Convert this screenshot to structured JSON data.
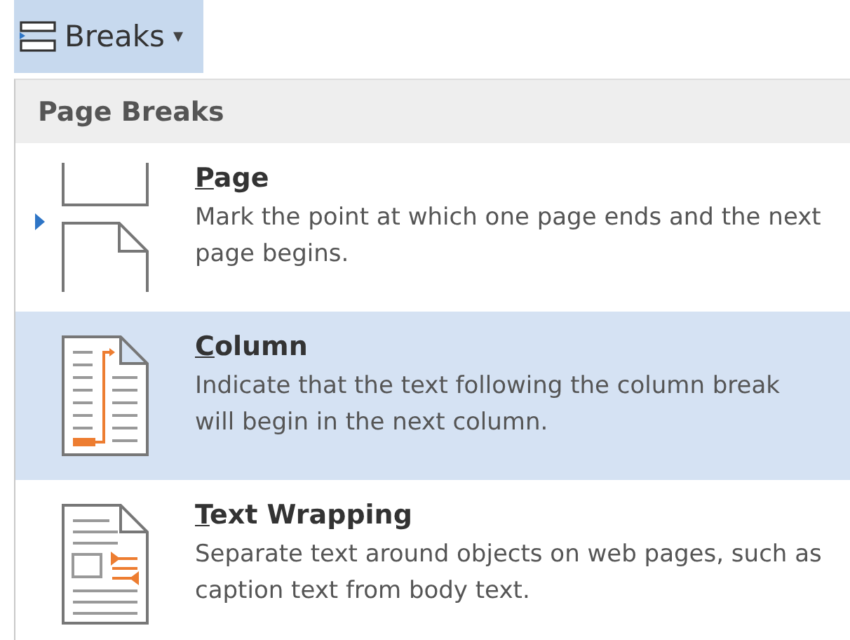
{
  "button": {
    "label": "Breaks",
    "caret": "▾"
  },
  "menu": {
    "header": "Page Breaks",
    "items": [
      {
        "kind": "page",
        "title": "Page",
        "description": "Mark the point at which one page ends and the next page begins.",
        "selected": false,
        "marker": true
      },
      {
        "kind": "column",
        "title": "Column",
        "description": "Indicate that the text following the column break will begin in the next column.",
        "selected": true,
        "marker": false
      },
      {
        "kind": "wrap",
        "title": "Text Wrapping",
        "description": "Separate text around objects on web pages, such as caption text from body text.",
        "selected": false,
        "marker": false
      }
    ]
  }
}
